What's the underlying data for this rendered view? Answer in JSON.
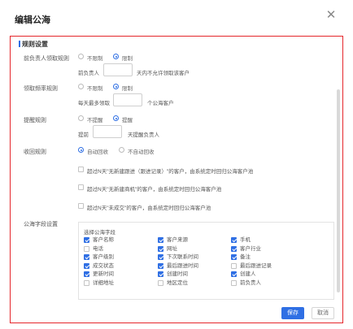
{
  "dialog": {
    "title": "编辑公海",
    "close_icon": "close-icon"
  },
  "section": {
    "title": "规则设置"
  },
  "rules": {
    "claim": {
      "label": "前负责人领取规则",
      "options": [
        "不限制",
        "限制"
      ],
      "selected": "限制",
      "prefix": "前负责人",
      "suffix": "天内不允许领取该客户",
      "value": ""
    },
    "limit": {
      "label": "领取频率规则",
      "options": [
        "不限制",
        "限制"
      ],
      "selected": "限制",
      "prefix": "每天最多领取",
      "suffix": "个公海客户",
      "value": ""
    },
    "remind": {
      "label": "提醒规则",
      "options": [
        "不提醒",
        "提醒"
      ],
      "selected": "提醒",
      "prefix": "提前",
      "suffix": "天提醒负责人",
      "value": ""
    },
    "recycle": {
      "label": "收回规则",
      "options": [
        "自动回收",
        "不自动回收"
      ],
      "selected": "自动回收",
      "conditions": [
        "超过N天\"无新建跟进（跟进记录）\"的客户，由系统定时回归公海客户池",
        "超过N天\"无新建商机\"的客户，由系统定时回归公海客户池",
        "超过N天\"未成交\"的客户，由系统定时回归公海客户池"
      ]
    }
  },
  "fields": {
    "label": "公海字段设置",
    "box_title": "选择公海字段",
    "items": [
      {
        "label": "客户名称",
        "checked": true
      },
      {
        "label": "客户来源",
        "checked": true
      },
      {
        "label": "手机",
        "checked": true
      },
      {
        "label": "电话",
        "checked": false
      },
      {
        "label": "网址",
        "checked": true
      },
      {
        "label": "客户行业",
        "checked": true
      },
      {
        "label": "客户级别",
        "checked": true
      },
      {
        "label": "下次联系时间",
        "checked": true
      },
      {
        "label": "备注",
        "checked": true
      },
      {
        "label": "成交状态",
        "checked": true
      },
      {
        "label": "最后跟进时间",
        "checked": true
      },
      {
        "label": "最后跟进记录",
        "checked": false
      },
      {
        "label": "更新时间",
        "checked": true
      },
      {
        "label": "创建时间",
        "checked": true
      },
      {
        "label": "创建人",
        "checked": true
      },
      {
        "label": "详细地址",
        "checked": false
      },
      {
        "label": "地区定位",
        "checked": false
      },
      {
        "label": "前负责人",
        "checked": false
      }
    ]
  },
  "footer": {
    "save_label": "保存",
    "cancel_label": "取消"
  },
  "colors": {
    "accent": "#2f6fe4",
    "highlight_border": "#e5262b"
  }
}
